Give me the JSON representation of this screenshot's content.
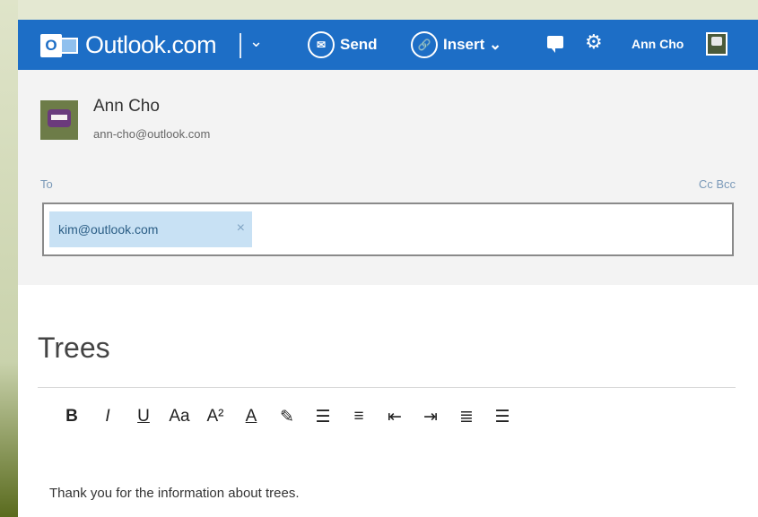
{
  "topbar": {
    "logo_letter": "O",
    "brand": "Outlook.com",
    "chevron": "⌄",
    "send_icon_text": "✉",
    "send_label": "Send",
    "insert_icon_text": "🔗",
    "insert_label": "Insert ⌄",
    "gear_icon": "⚙",
    "user_name": "Ann Cho"
  },
  "message": {
    "sender_name": "Ann Cho",
    "sender_email": "ann-cho@outlook.com",
    "to_label": "To",
    "cc_bcc": "Cc Bcc",
    "recipients": [
      {
        "email": "kim@outlook.com",
        "remove": "×"
      }
    ],
    "subject": "Trees",
    "body": "Thank you for the information about trees."
  },
  "format_toolbar": {
    "items": [
      {
        "name": "bold",
        "glyph": "B"
      },
      {
        "name": "italic",
        "glyph": "I"
      },
      {
        "name": "underline",
        "glyph": "U"
      },
      {
        "name": "font-size",
        "glyph": "Aa"
      },
      {
        "name": "superscript",
        "glyph": "A²"
      },
      {
        "name": "font-color",
        "glyph": "A"
      },
      {
        "name": "highlight",
        "glyph": "✎"
      },
      {
        "name": "numbered-list",
        "glyph": "☰"
      },
      {
        "name": "bullet-list",
        "glyph": "≡"
      },
      {
        "name": "decrease-indent",
        "glyph": "⇤"
      },
      {
        "name": "increase-indent",
        "glyph": "⇥"
      },
      {
        "name": "align-left",
        "glyph": "≣"
      },
      {
        "name": "align-center",
        "glyph": "☰"
      }
    ]
  },
  "colors": {
    "topbar": "#1d6ec6",
    "chip": "#c8e1f4",
    "header_bg": "#f3f3f3"
  }
}
